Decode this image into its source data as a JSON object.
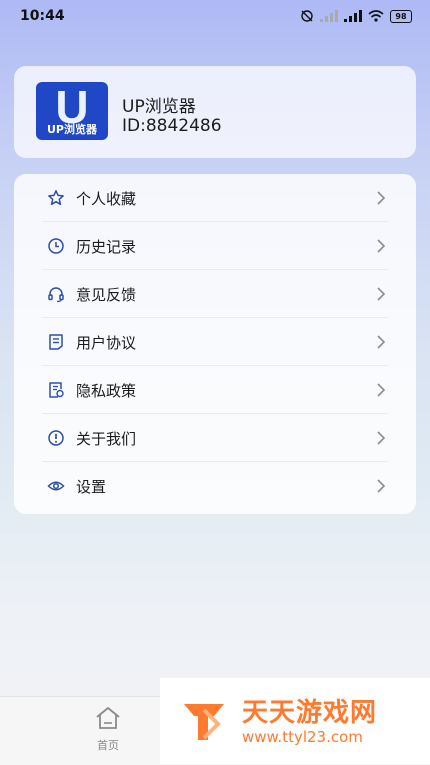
{
  "status_bar": {
    "time": "10:44",
    "battery": "98"
  },
  "profile": {
    "logo_letter": "U",
    "logo_text": "UP浏览器",
    "name": "UP浏览器",
    "id": "ID:8842486"
  },
  "menu": {
    "items": [
      {
        "label": "个人收藏",
        "icon": "star-icon"
      },
      {
        "label": "历史记录",
        "icon": "clock-icon"
      },
      {
        "label": "意见反馈",
        "icon": "headset-icon"
      },
      {
        "label": "用户协议",
        "icon": "document-icon"
      },
      {
        "label": "隐私政策",
        "icon": "privacy-doc-icon"
      },
      {
        "label": "关于我们",
        "icon": "info-icon"
      },
      {
        "label": "设置",
        "icon": "eye-icon"
      }
    ]
  },
  "bottom_nav": {
    "home_label": "首页"
  },
  "watermark": {
    "title": "天天游戏网",
    "url": "www.ttyl23.com"
  },
  "colors": {
    "accent": "#1f47c6",
    "icon": "#2e4fa8",
    "watermark": "#ff7a2f"
  }
}
